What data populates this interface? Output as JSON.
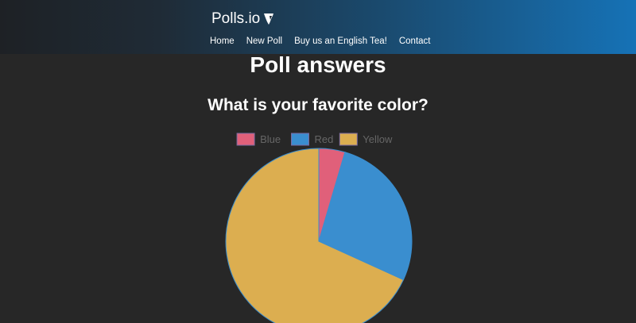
{
  "navbar": {
    "brand": "Polls.io",
    "brand_icon": "typo3-logo-icon",
    "links": [
      {
        "label": "Home"
      },
      {
        "label": "New Poll"
      },
      {
        "label": "Buy us an English Tea!"
      },
      {
        "label": "Contact"
      }
    ]
  },
  "main": {
    "title": "Poll answers",
    "question": "What is your favorite color?"
  },
  "colors": {
    "background": "#272727",
    "nav_gradient_start": "#1e2125",
    "nav_gradient_end": "#1672b6",
    "blue_series": "#e0607a",
    "red_series": "#3a8ecf",
    "yellow_series": "#dcae50",
    "legend_text": "#666666"
  },
  "chart_data": {
    "type": "pie",
    "title": "",
    "categories": [
      "Blue",
      "Red",
      "Yellow"
    ],
    "values": [
      1,
      6,
      15
    ],
    "colors": [
      "#e0607a",
      "#3a8ecf",
      "#dcae50"
    ],
    "legend": "top-center"
  }
}
